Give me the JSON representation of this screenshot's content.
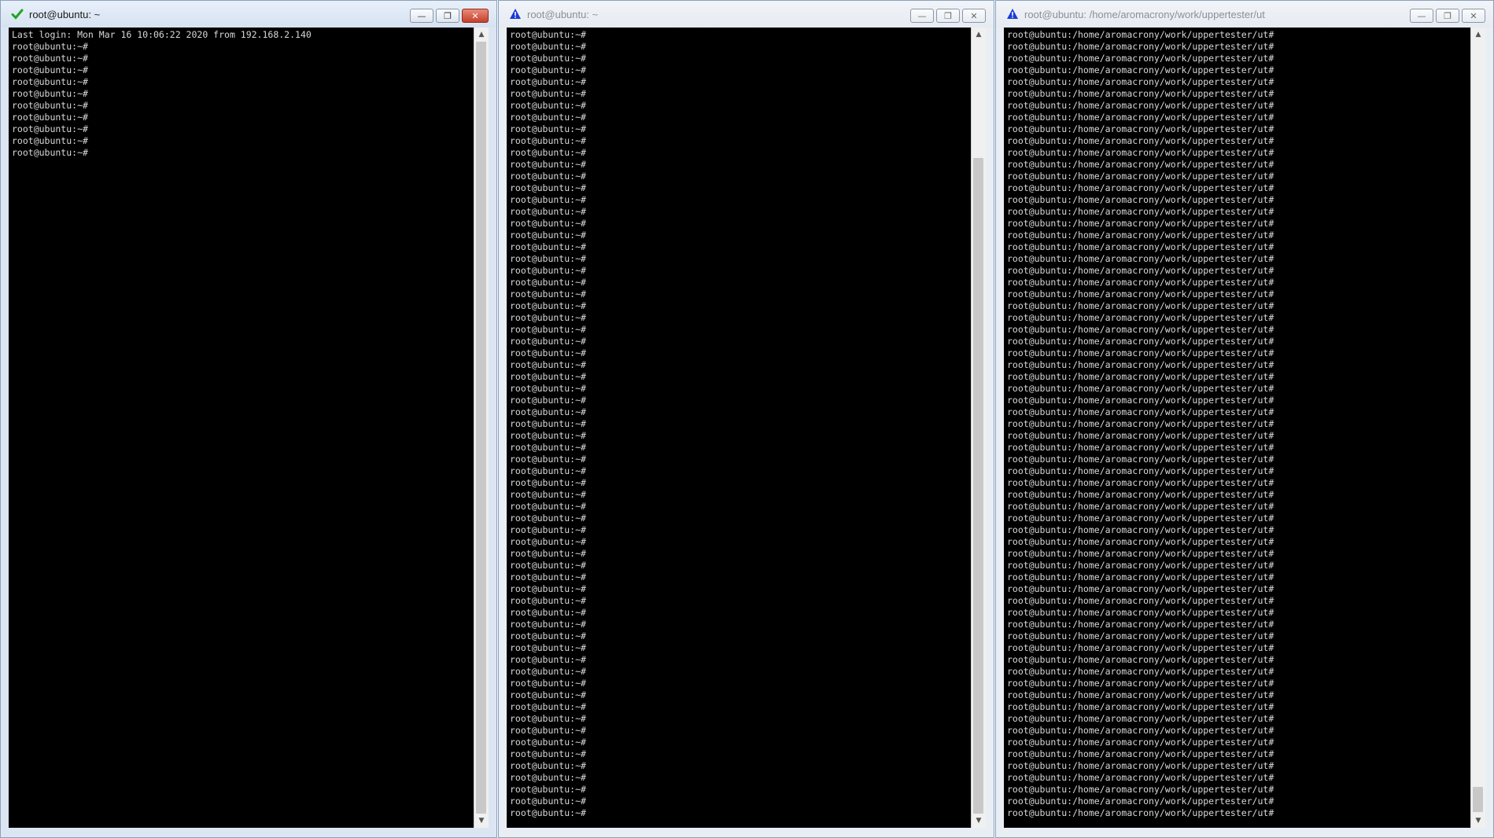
{
  "windows": [
    {
      "title": "root@ubuntu: ~",
      "status_icon": "checkmark-icon",
      "status_color": "#1fa51f",
      "controls": {
        "minimize": "—",
        "restore": "❐",
        "close": "✕"
      },
      "lines": [
        "Last login: Mon Mar 16 10:06:22 2020 from 192.168.2.140",
        "root@ubuntu:~#",
        "root@ubuntu:~#",
        "root@ubuntu:~#",
        "root@ubuntu:~#",
        "root@ubuntu:~#",
        "root@ubuntu:~#",
        "root@ubuntu:~#",
        "root@ubuntu:~#",
        "root@ubuntu:~#",
        "root@ubuntu:~#"
      ]
    },
    {
      "title": "root@ubuntu: ~",
      "status_icon": "warning-icon",
      "status_color": "#1b3bd6",
      "controls": {
        "minimize": "—",
        "restore": "❐",
        "close": "✕"
      },
      "lines": [
        "root@ubuntu:~#",
        "root@ubuntu:~#",
        "root@ubuntu:~#",
        "root@ubuntu:~#",
        "root@ubuntu:~#",
        "root@ubuntu:~#",
        "root@ubuntu:~#",
        "root@ubuntu:~#",
        "root@ubuntu:~#",
        "root@ubuntu:~#",
        "root@ubuntu:~#",
        "root@ubuntu:~#",
        "root@ubuntu:~#",
        "root@ubuntu:~#",
        "root@ubuntu:~#",
        "root@ubuntu:~#",
        "root@ubuntu:~#",
        "root@ubuntu:~#",
        "root@ubuntu:~#",
        "root@ubuntu:~#",
        "root@ubuntu:~#",
        "root@ubuntu:~#",
        "root@ubuntu:~#",
        "root@ubuntu:~#",
        "root@ubuntu:~#",
        "root@ubuntu:~#",
        "root@ubuntu:~#",
        "root@ubuntu:~#",
        "root@ubuntu:~#",
        "root@ubuntu:~#",
        "root@ubuntu:~#",
        "root@ubuntu:~#",
        "root@ubuntu:~#",
        "root@ubuntu:~#",
        "root@ubuntu:~#",
        "root@ubuntu:~#",
        "root@ubuntu:~#",
        "root@ubuntu:~#",
        "root@ubuntu:~#",
        "root@ubuntu:~#",
        "root@ubuntu:~#",
        "root@ubuntu:~#",
        "root@ubuntu:~#",
        "root@ubuntu:~#",
        "root@ubuntu:~#",
        "root@ubuntu:~#",
        "root@ubuntu:~#",
        "root@ubuntu:~#",
        "root@ubuntu:~#",
        "root@ubuntu:~#",
        "root@ubuntu:~#",
        "root@ubuntu:~#",
        "root@ubuntu:~#",
        "root@ubuntu:~#",
        "root@ubuntu:~#",
        "root@ubuntu:~#",
        "root@ubuntu:~#",
        "root@ubuntu:~#",
        "root@ubuntu:~#",
        "root@ubuntu:~#",
        "root@ubuntu:~#",
        "root@ubuntu:~#",
        "root@ubuntu:~#",
        "root@ubuntu:~#",
        "root@ubuntu:~#",
        "root@ubuntu:~#",
        "root@ubuntu:~#"
      ]
    },
    {
      "title": "root@ubuntu: /home/aromacrony/work/uppertester/ut",
      "status_icon": "warning-icon",
      "status_color": "#1b3bd6",
      "controls": {
        "minimize": "—",
        "restore": "❐",
        "close": "✕"
      },
      "lines": [
        "root@ubuntu:/home/aromacrony/work/uppertester/ut#",
        "root@ubuntu:/home/aromacrony/work/uppertester/ut#",
        "root@ubuntu:/home/aromacrony/work/uppertester/ut#",
        "root@ubuntu:/home/aromacrony/work/uppertester/ut#",
        "root@ubuntu:/home/aromacrony/work/uppertester/ut#",
        "root@ubuntu:/home/aromacrony/work/uppertester/ut#",
        "root@ubuntu:/home/aromacrony/work/uppertester/ut#",
        "root@ubuntu:/home/aromacrony/work/uppertester/ut#",
        "root@ubuntu:/home/aromacrony/work/uppertester/ut#",
        "root@ubuntu:/home/aromacrony/work/uppertester/ut#",
        "root@ubuntu:/home/aromacrony/work/uppertester/ut#",
        "root@ubuntu:/home/aromacrony/work/uppertester/ut#",
        "root@ubuntu:/home/aromacrony/work/uppertester/ut#",
        "root@ubuntu:/home/aromacrony/work/uppertester/ut#",
        "root@ubuntu:/home/aromacrony/work/uppertester/ut#",
        "root@ubuntu:/home/aromacrony/work/uppertester/ut#",
        "root@ubuntu:/home/aromacrony/work/uppertester/ut#",
        "root@ubuntu:/home/aromacrony/work/uppertester/ut#",
        "root@ubuntu:/home/aromacrony/work/uppertester/ut#",
        "root@ubuntu:/home/aromacrony/work/uppertester/ut#",
        "root@ubuntu:/home/aromacrony/work/uppertester/ut#",
        "root@ubuntu:/home/aromacrony/work/uppertester/ut#",
        "root@ubuntu:/home/aromacrony/work/uppertester/ut#",
        "root@ubuntu:/home/aromacrony/work/uppertester/ut#",
        "root@ubuntu:/home/aromacrony/work/uppertester/ut#",
        "root@ubuntu:/home/aromacrony/work/uppertester/ut#",
        "root@ubuntu:/home/aromacrony/work/uppertester/ut#",
        "root@ubuntu:/home/aromacrony/work/uppertester/ut#",
        "root@ubuntu:/home/aromacrony/work/uppertester/ut#",
        "root@ubuntu:/home/aromacrony/work/uppertester/ut#",
        "root@ubuntu:/home/aromacrony/work/uppertester/ut#",
        "root@ubuntu:/home/aromacrony/work/uppertester/ut#",
        "root@ubuntu:/home/aromacrony/work/uppertester/ut#",
        "root@ubuntu:/home/aromacrony/work/uppertester/ut#",
        "root@ubuntu:/home/aromacrony/work/uppertester/ut#",
        "root@ubuntu:/home/aromacrony/work/uppertester/ut#",
        "root@ubuntu:/home/aromacrony/work/uppertester/ut#",
        "root@ubuntu:/home/aromacrony/work/uppertester/ut#",
        "root@ubuntu:/home/aromacrony/work/uppertester/ut#",
        "root@ubuntu:/home/aromacrony/work/uppertester/ut#",
        "root@ubuntu:/home/aromacrony/work/uppertester/ut#",
        "root@ubuntu:/home/aromacrony/work/uppertester/ut#",
        "root@ubuntu:/home/aromacrony/work/uppertester/ut#",
        "root@ubuntu:/home/aromacrony/work/uppertester/ut#",
        "root@ubuntu:/home/aromacrony/work/uppertester/ut#",
        "root@ubuntu:/home/aromacrony/work/uppertester/ut#",
        "root@ubuntu:/home/aromacrony/work/uppertester/ut#",
        "root@ubuntu:/home/aromacrony/work/uppertester/ut#",
        "root@ubuntu:/home/aromacrony/work/uppertester/ut#",
        "root@ubuntu:/home/aromacrony/work/uppertester/ut#",
        "root@ubuntu:/home/aromacrony/work/uppertester/ut#",
        "root@ubuntu:/home/aromacrony/work/uppertester/ut#",
        "root@ubuntu:/home/aromacrony/work/uppertester/ut#",
        "root@ubuntu:/home/aromacrony/work/uppertester/ut#",
        "root@ubuntu:/home/aromacrony/work/uppertester/ut#",
        "root@ubuntu:/home/aromacrony/work/uppertester/ut#",
        "root@ubuntu:/home/aromacrony/work/uppertester/ut#",
        "root@ubuntu:/home/aromacrony/work/uppertester/ut#",
        "root@ubuntu:/home/aromacrony/work/uppertester/ut#",
        "root@ubuntu:/home/aromacrony/work/uppertester/ut#",
        "root@ubuntu:/home/aromacrony/work/uppertester/ut#",
        "root@ubuntu:/home/aromacrony/work/uppertester/ut#",
        "root@ubuntu:/home/aromacrony/work/uppertester/ut#",
        "root@ubuntu:/home/aromacrony/work/uppertester/ut#",
        "root@ubuntu:/home/aromacrony/work/uppertester/ut#",
        "root@ubuntu:/home/aromacrony/work/uppertester/ut#",
        "root@ubuntu:/home/aromacrony/work/uppertester/ut#"
      ]
    }
  ]
}
